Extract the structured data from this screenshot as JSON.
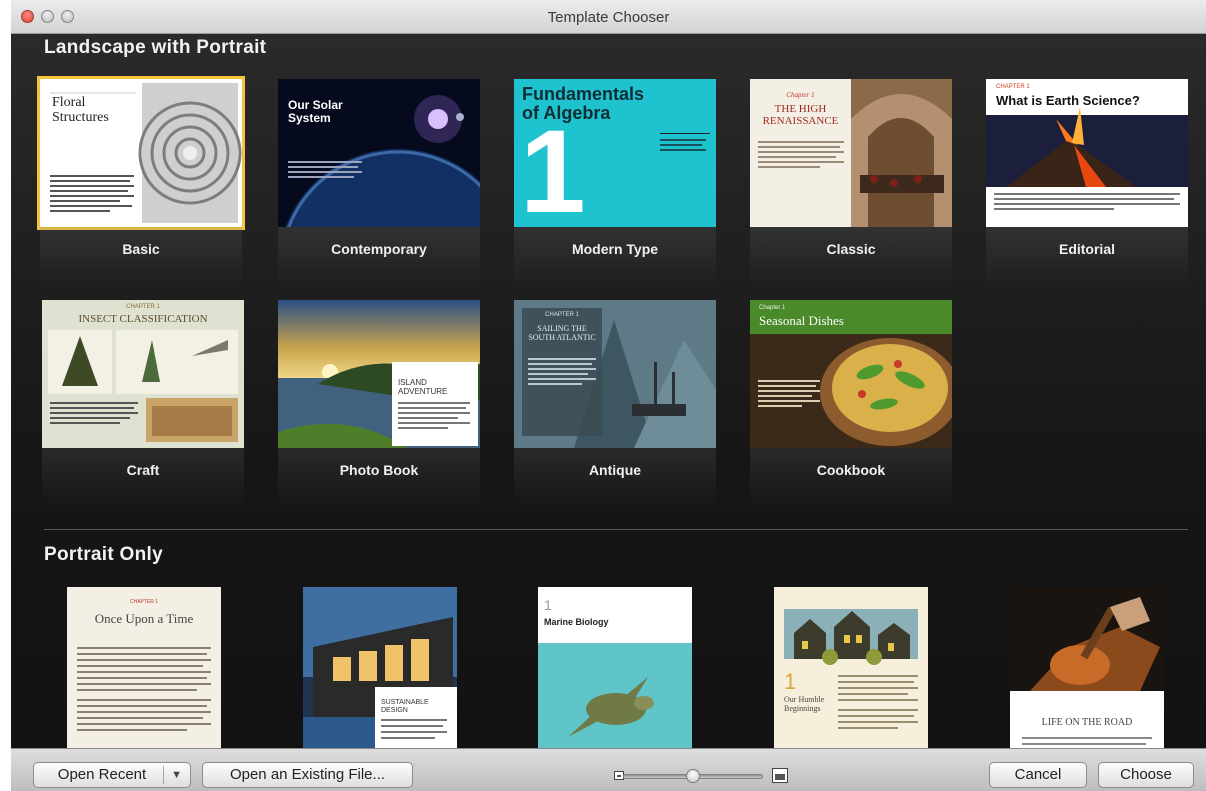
{
  "window": {
    "title": "Template Chooser"
  },
  "sections": {
    "landscape_title": "Landscape with Portrait",
    "portrait_title": "Portrait Only"
  },
  "landscape_templates": [
    {
      "label": "Basic",
      "selected": true,
      "thumb_title": "Floral\nStructures"
    },
    {
      "label": "Contemporary",
      "thumb_title": "Our Solar\nSystem"
    },
    {
      "label": "Modern Type",
      "thumb_title": "Fundamentals\nof Algebra",
      "thumb_num": "1"
    },
    {
      "label": "Classic",
      "thumb_title": "THE HIGH\nRENAISSANCE",
      "thumb_kicker": "Chapter 1"
    },
    {
      "label": "Editorial",
      "thumb_title": "What is Earth Science?",
      "thumb_kicker": "CHAPTER 1"
    },
    {
      "label": "Craft",
      "thumb_title": "INSECT CLASSIFICATION",
      "thumb_kicker": "CHAPTER 1"
    },
    {
      "label": "Photo Book",
      "thumb_title": "ISLAND\nADVENTURE"
    },
    {
      "label": "Antique",
      "thumb_title": "SAILING THE\nSOUTH ATLANTIC",
      "thumb_kicker": "CHAPTER 1"
    },
    {
      "label": "Cookbook",
      "thumb_title": "Seasonal Dishes",
      "thumb_kicker": "Chapter 1"
    }
  ],
  "portrait_templates": [
    {
      "thumb_title": "Once Upon a Time",
      "thumb_kicker": "CHAPTER 1"
    },
    {
      "thumb_title": "SUSTAINABLE\nDESIGN"
    },
    {
      "thumb_title": "Marine Biology",
      "thumb_num": "1"
    },
    {
      "thumb_title": "Our Humble\nBeginnings",
      "thumb_num": "1"
    },
    {
      "thumb_title": "LIFE ON THE ROAD"
    }
  ],
  "bottom_bar": {
    "open_recent": "Open Recent",
    "open_existing": "Open an Existing File...",
    "cancel": "Cancel",
    "choose": "Choose",
    "zoom_level": 0.5
  },
  "colors": {
    "selection": "#f3c43c",
    "background": "#1c1c1c",
    "modern_type_teal": "#1fc2cf",
    "cookbook_green": "#4a8a2a",
    "editorial_red": "#d63a1c"
  }
}
